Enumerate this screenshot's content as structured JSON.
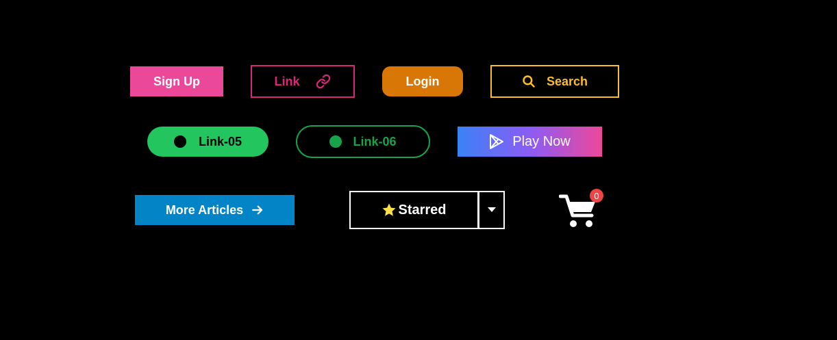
{
  "colors": {
    "background": "#000000",
    "signup_bg": "#ec4899",
    "link_border": "#db2777",
    "login_bg": "#d97706",
    "search_border": "#fbbf24",
    "link05_bg": "#22c55e",
    "link06_border": "#16a34a",
    "play_gradient": [
      "#3b82f6",
      "#8b5cf6",
      "#ec4899"
    ],
    "more_bg": "#0284c7",
    "star": "#fde047",
    "badge": "#ef4444"
  },
  "buttons": {
    "signup": {
      "label": "Sign Up"
    },
    "link": {
      "label": "Link",
      "icon": "link-icon"
    },
    "login": {
      "label": "Login"
    },
    "search": {
      "label": "Search",
      "icon": "search-icon"
    },
    "link05": {
      "label": "Link-05",
      "icon": "dot-icon"
    },
    "link06": {
      "label": "Link-06",
      "icon": "dot-icon"
    },
    "playnow": {
      "label": "Play Now",
      "icon": "play-store-icon"
    },
    "more": {
      "label": "More Articles",
      "icon": "arrow-right-icon"
    },
    "starred": {
      "label": "Starred",
      "icon": "star-icon",
      "toggle_icon": "caret-down-icon"
    }
  },
  "cart": {
    "icon": "cart-icon",
    "count": "0"
  }
}
